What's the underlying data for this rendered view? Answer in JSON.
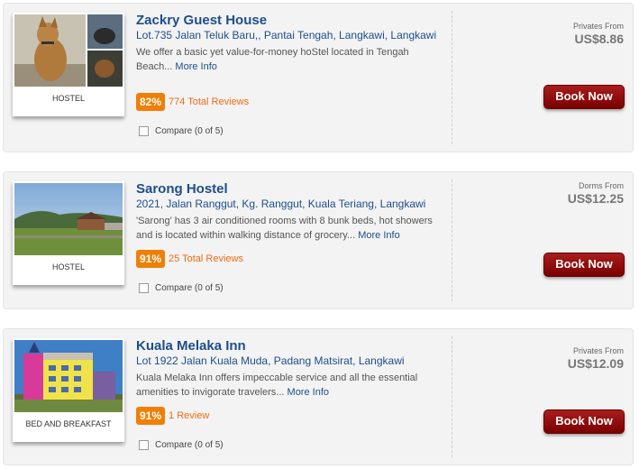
{
  "listings": [
    {
      "name": "Zackry Guest House",
      "address": "Lot.735 Jalan Teluk Baru,, Pantai Tengah, Langkawi, Langkawi",
      "description": "We offer a basic yet value-for-money hoStel located in Tengah Beach...",
      "more_label": "More Info",
      "type": "HOSTEL",
      "rating": "82%",
      "reviews": "774 Total Reviews",
      "compare": "Compare (0 of 5)",
      "price_label": "Privates From",
      "price": "US$8.86",
      "book_label": "Book Now"
    },
    {
      "name": "Sarong Hostel",
      "address": "2021, Jalan Ranggut, Kg. Ranggut, Kuala Teriang, Langkawi",
      "description": "'Sarong' has 3 air conditioned rooms with 8 bunk beds, hot showers and is located within walking distance of grocery...",
      "more_label": "More Info",
      "type": "HOSTEL",
      "rating": "91%",
      "reviews": "25 Total Reviews",
      "compare": "Compare (0 of 5)",
      "price_label": "Dorms From",
      "price": "US$12.25",
      "book_label": "Book Now"
    },
    {
      "name": "Kuala Melaka Inn",
      "address": "Lot 1922 Jalan Kuala Muda, Padang Matsirat, Langkawi",
      "description": "Kuala Melaka Inn offers impeccable service and all the essential amenities to invigorate travelers...",
      "more_label": "More Info",
      "type": "BED AND BREAKFAST",
      "rating": "91%",
      "reviews": "1 Review",
      "compare": "Compare (0 of 5)",
      "price_label": "Privates From",
      "price": "US$12.09",
      "book_label": "Book Now"
    }
  ],
  "colors": {
    "title": "#1d4e89",
    "rating_badge": "#f07f06",
    "reviews": "#ef6b12",
    "book_button": "#8b0a0a",
    "card_bg": "#f3f3f3"
  }
}
